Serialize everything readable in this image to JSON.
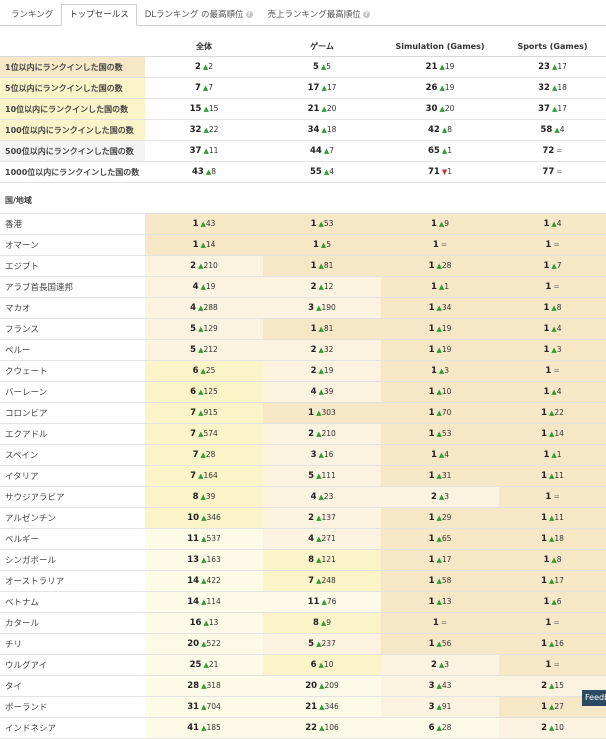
{
  "tabs": [
    {
      "label": "ランキング",
      "help": false,
      "active": false
    },
    {
      "label": "トップセールス",
      "help": false,
      "active": true
    },
    {
      "label": "DLランキング の最高順位",
      "help": true,
      "active": false
    },
    {
      "label": "売上ランキング最高順位",
      "help": true,
      "active": false
    }
  ],
  "columns": [
    "",
    "全体",
    "ゲーム",
    "Simulation (Games)",
    "Sports (Games)"
  ],
  "summary_rows": [
    {
      "label": "1位以内にランクインした国の数",
      "values": [
        [
          "2",
          "up",
          "2"
        ],
        [
          "5",
          "up",
          "5"
        ],
        [
          "21",
          "up",
          "19"
        ],
        [
          "23",
          "up",
          "17"
        ]
      ]
    },
    {
      "label": "5位以内にランクインした国の数",
      "values": [
        [
          "7",
          "up",
          "7"
        ],
        [
          "17",
          "up",
          "17"
        ],
        [
          "26",
          "up",
          "19"
        ],
        [
          "32",
          "up",
          "18"
        ]
      ]
    },
    {
      "label": "10位以内にランクインした国の数",
      "values": [
        [
          "15",
          "up",
          "15"
        ],
        [
          "21",
          "up",
          "20"
        ],
        [
          "30",
          "up",
          "20"
        ],
        [
          "37",
          "up",
          "17"
        ]
      ]
    },
    {
      "label": "100位以内にランクインした国の数",
      "values": [
        [
          "32",
          "up",
          "22"
        ],
        [
          "34",
          "up",
          "18"
        ],
        [
          "42",
          "up",
          "8"
        ],
        [
          "58",
          "up",
          "4"
        ]
      ]
    },
    {
      "label": "500位以内にランクインした国の数",
      "values": [
        [
          "37",
          "up",
          "11"
        ],
        [
          "44",
          "up",
          "7"
        ],
        [
          "65",
          "up",
          "1"
        ],
        [
          "72",
          "flat",
          "="
        ]
      ]
    },
    {
      "label": "1000位以内にランクインした国の数",
      "values": [
        [
          "43",
          "up",
          "8"
        ],
        [
          "55",
          "up",
          "4"
        ],
        [
          "71",
          "dn",
          "1"
        ],
        [
          "77",
          "flat",
          "="
        ]
      ]
    }
  ],
  "section_label": "国/地域",
  "country_rows": [
    {
      "label": "香港",
      "values": [
        [
          "1",
          "up",
          "43"
        ],
        [
          "1",
          "up",
          "53"
        ],
        [
          "1",
          "up",
          "9"
        ],
        [
          "1",
          "up",
          "4"
        ]
      ]
    },
    {
      "label": "オマーン",
      "values": [
        [
          "1",
          "up",
          "14"
        ],
        [
          "1",
          "up",
          "5"
        ],
        [
          "1",
          "flat",
          "="
        ],
        [
          "1",
          "flat",
          "="
        ]
      ]
    },
    {
      "label": "エジプト",
      "values": [
        [
          "2",
          "up",
          "210"
        ],
        [
          "1",
          "up",
          "81"
        ],
        [
          "1",
          "up",
          "28"
        ],
        [
          "1",
          "up",
          "7"
        ]
      ]
    },
    {
      "label": "アラブ首長国連邦",
      "values": [
        [
          "4",
          "up",
          "19"
        ],
        [
          "2",
          "up",
          "12"
        ],
        [
          "1",
          "up",
          "1"
        ],
        [
          "1",
          "flat",
          "="
        ]
      ]
    },
    {
      "label": "マカオ",
      "values": [
        [
          "4",
          "up",
          "288"
        ],
        [
          "3",
          "up",
          "190"
        ],
        [
          "1",
          "up",
          "34"
        ],
        [
          "1",
          "up",
          "8"
        ]
      ]
    },
    {
      "label": "フランス",
      "values": [
        [
          "5",
          "up",
          "129"
        ],
        [
          "1",
          "up",
          "81"
        ],
        [
          "1",
          "up",
          "19"
        ],
        [
          "1",
          "up",
          "4"
        ]
      ]
    },
    {
      "label": "ペルー",
      "values": [
        [
          "5",
          "up",
          "212"
        ],
        [
          "2",
          "up",
          "32"
        ],
        [
          "1",
          "up",
          "19"
        ],
        [
          "1",
          "up",
          "3"
        ]
      ]
    },
    {
      "label": "クウェート",
      "values": [
        [
          "6",
          "up",
          "25"
        ],
        [
          "2",
          "up",
          "19"
        ],
        [
          "1",
          "up",
          "3"
        ],
        [
          "1",
          "flat",
          "="
        ]
      ]
    },
    {
      "label": "バーレーン",
      "values": [
        [
          "6",
          "up",
          "125"
        ],
        [
          "4",
          "up",
          "39"
        ],
        [
          "1",
          "up",
          "10"
        ],
        [
          "1",
          "up",
          "4"
        ]
      ]
    },
    {
      "label": "コロンビア",
      "values": [
        [
          "7",
          "up",
          "915"
        ],
        [
          "1",
          "up",
          "303"
        ],
        [
          "1",
          "up",
          "70"
        ],
        [
          "1",
          "up",
          "22"
        ]
      ]
    },
    {
      "label": "エクアドル",
      "values": [
        [
          "7",
          "up",
          "574"
        ],
        [
          "2",
          "up",
          "210"
        ],
        [
          "1",
          "up",
          "53"
        ],
        [
          "1",
          "up",
          "14"
        ]
      ]
    },
    {
      "label": "スペイン",
      "values": [
        [
          "7",
          "up",
          "28"
        ],
        [
          "3",
          "up",
          "16"
        ],
        [
          "1",
          "up",
          "4"
        ],
        [
          "1",
          "up",
          "1"
        ]
      ]
    },
    {
      "label": "イタリア",
      "values": [
        [
          "7",
          "up",
          "164"
        ],
        [
          "5",
          "up",
          "111"
        ],
        [
          "1",
          "up",
          "31"
        ],
        [
          "1",
          "up",
          "11"
        ]
      ]
    },
    {
      "label": "サウジアラビア",
      "values": [
        [
          "8",
          "up",
          "39"
        ],
        [
          "4",
          "up",
          "23"
        ],
        [
          "2",
          "up",
          "3"
        ],
        [
          "1",
          "flat",
          "="
        ]
      ]
    },
    {
      "label": "アルゼンチン",
      "values": [
        [
          "10",
          "up",
          "346"
        ],
        [
          "2",
          "up",
          "137"
        ],
        [
          "1",
          "up",
          "29"
        ],
        [
          "1",
          "up",
          "11"
        ]
      ]
    },
    {
      "label": "ベルギー",
      "values": [
        [
          "11",
          "up",
          "537"
        ],
        [
          "4",
          "up",
          "271"
        ],
        [
          "1",
          "up",
          "65"
        ],
        [
          "1",
          "up",
          "18"
        ]
      ]
    },
    {
      "label": "シンガポール",
      "values": [
        [
          "13",
          "up",
          "163"
        ],
        [
          "8",
          "up",
          "121"
        ],
        [
          "1",
          "up",
          "17"
        ],
        [
          "1",
          "up",
          "8"
        ]
      ]
    },
    {
      "label": "オーストラリア",
      "values": [
        [
          "14",
          "up",
          "422"
        ],
        [
          "7",
          "up",
          "248"
        ],
        [
          "1",
          "up",
          "58"
        ],
        [
          "1",
          "up",
          "17"
        ]
      ]
    },
    {
      "label": "ベトナム",
      "values": [
        [
          "14",
          "up",
          "114"
        ],
        [
          "11",
          "up",
          "76"
        ],
        [
          "1",
          "up",
          "13"
        ],
        [
          "1",
          "up",
          "6"
        ]
      ]
    },
    {
      "label": "カタール",
      "values": [
        [
          "16",
          "up",
          "13"
        ],
        [
          "8",
          "up",
          "9"
        ],
        [
          "1",
          "flat",
          "="
        ],
        [
          "1",
          "flat",
          "="
        ]
      ]
    },
    {
      "label": "チリ",
      "values": [
        [
          "20",
          "up",
          "522"
        ],
        [
          "5",
          "up",
          "237"
        ],
        [
          "1",
          "up",
          "56"
        ],
        [
          "1",
          "up",
          "16"
        ]
      ]
    },
    {
      "label": "ウルグアイ",
      "values": [
        [
          "25",
          "up",
          "21"
        ],
        [
          "6",
          "up",
          "10"
        ],
        [
          "2",
          "up",
          "3"
        ],
        [
          "1",
          "flat",
          "="
        ]
      ]
    },
    {
      "label": "タイ",
      "values": [
        [
          "28",
          "up",
          "318"
        ],
        [
          "20",
          "up",
          "209"
        ],
        [
          "3",
          "up",
          "43"
        ],
        [
          "2",
          "up",
          "15"
        ]
      ]
    },
    {
      "label": "ポーランド",
      "values": [
        [
          "31",
          "up",
          "704"
        ],
        [
          "21",
          "up",
          "346"
        ],
        [
          "3",
          "up",
          "91"
        ],
        [
          "1",
          "up",
          "27"
        ]
      ]
    },
    {
      "label": "インドネシア",
      "values": [
        [
          "41",
          "up",
          "185"
        ],
        [
          "22",
          "up",
          "106"
        ],
        [
          "6",
          "up",
          "28"
        ],
        [
          "2",
          "up",
          "10"
        ]
      ]
    }
  ],
  "feedback_label": "Feedback",
  "colors": {
    "up": "#2e9e36",
    "down": "#c0392b",
    "highlight_yellow": "#fbf4c9",
    "highlight_tan": "#f6e8c7"
  }
}
